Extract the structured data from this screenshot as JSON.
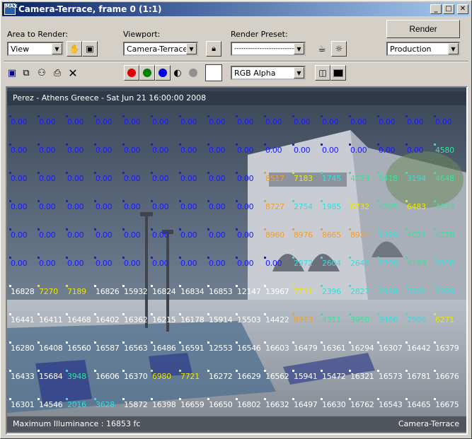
{
  "window": {
    "title": "Camera-Terrace, frame 0 (1:1)"
  },
  "toolbar": {
    "area_label": "Area to Render:",
    "area_value": "View",
    "viewport_label": "Viewport:",
    "viewport_value": "Camera-Terrace",
    "preset_label": "Render Preset:",
    "preset_value": "--------------------------",
    "render_label": "Render",
    "mode_value": "Production",
    "channel_value": "RGB Alpha"
  },
  "colors": {
    "blue": "#1a1aff",
    "yellow": "#e8e800",
    "orange": "#f0a030",
    "cyan": "#2ee0e0",
    "green": "#2ee89a",
    "white": "#ffffff"
  },
  "viewport": {
    "header": "Perez - Athens Greece - Sat Jun 21 16:00:00 2008",
    "footer_left": "Maximum Illuminance : 16853 fc",
    "footer_right": "Camera-Terrace"
  },
  "grid": {
    "rows": [
      [
        [
          "0.00",
          "b"
        ],
        [
          "0.00",
          "b"
        ],
        [
          "0.00",
          "b"
        ],
        [
          "0.00",
          "b"
        ],
        [
          "0.00",
          "b"
        ],
        [
          "0.00",
          "b"
        ],
        [
          "0.00",
          "b"
        ],
        [
          "0.00",
          "b"
        ],
        [
          "0.00",
          "b"
        ],
        [
          "0.00",
          "b"
        ],
        [
          "0.00",
          "b"
        ],
        [
          "0.00",
          "b"
        ],
        [
          "0.00",
          "b"
        ],
        [
          "0.00",
          "b"
        ],
        [
          "0.00",
          "b"
        ],
        [
          "0.00",
          "b"
        ]
      ],
      [
        [
          "0.00",
          "b"
        ],
        [
          "0.00",
          "b"
        ],
        [
          "0.00",
          "b"
        ],
        [
          "0.00",
          "b"
        ],
        [
          "0.00",
          "b"
        ],
        [
          "0.00",
          "b"
        ],
        [
          "0.00",
          "b"
        ],
        [
          "0.00",
          "b"
        ],
        [
          "0.00",
          "b"
        ],
        [
          "0.00",
          "b"
        ],
        [
          "0.00",
          "b"
        ],
        [
          "0.00",
          "b"
        ],
        [
          "0.00",
          "b"
        ],
        [
          "0.00",
          "b"
        ],
        [
          "0.00",
          "b"
        ],
        [
          "4580",
          "g"
        ]
      ],
      [
        [
          "0.00",
          "b"
        ],
        [
          "0.00",
          "b"
        ],
        [
          "0.00",
          "b"
        ],
        [
          "0.00",
          "b"
        ],
        [
          "0.00",
          "b"
        ],
        [
          "0.00",
          "b"
        ],
        [
          "0.00",
          "b"
        ],
        [
          "0.00",
          "b"
        ],
        [
          "0.00",
          "b"
        ],
        [
          "8517",
          "o"
        ],
        [
          "7183",
          "y"
        ],
        [
          "1745",
          "c"
        ],
        [
          "4273",
          "g"
        ],
        [
          "5418",
          "g"
        ],
        [
          "3194",
          "c"
        ],
        [
          "4648",
          "g"
        ]
      ],
      [
        [
          "0.00",
          "b"
        ],
        [
          "0.00",
          "b"
        ],
        [
          "0.00",
          "b"
        ],
        [
          "0.00",
          "b"
        ],
        [
          "0.00",
          "b"
        ],
        [
          "0.00",
          "b"
        ],
        [
          "0.00",
          "b"
        ],
        [
          "0.00",
          "b"
        ],
        [
          "0.00",
          "b"
        ],
        [
          "8727",
          "o"
        ],
        [
          "2754",
          "c"
        ],
        [
          "1985",
          "c"
        ],
        [
          "6732",
          "y"
        ],
        [
          "4205",
          "g"
        ],
        [
          "6483",
          "y"
        ],
        [
          "4634",
          "g"
        ]
      ],
      [
        [
          "0.00",
          "b"
        ],
        [
          "0.00",
          "b"
        ],
        [
          "0.00",
          "b"
        ],
        [
          "0.00",
          "b"
        ],
        [
          "0.00",
          "b"
        ],
        [
          "0.00",
          "b"
        ],
        [
          "0.00",
          "b"
        ],
        [
          "0.00",
          "b"
        ],
        [
          "0.00",
          "b"
        ],
        [
          "8960",
          "o"
        ],
        [
          "8976",
          "o"
        ],
        [
          "8665",
          "o"
        ],
        [
          "8924",
          "o"
        ],
        [
          "1326",
          "c"
        ],
        [
          "4621",
          "g"
        ],
        [
          "4278",
          "g"
        ]
      ],
      [
        [
          "0.00",
          "b"
        ],
        [
          "0.00",
          "b"
        ],
        [
          "0.00",
          "b"
        ],
        [
          "0.00",
          "b"
        ],
        [
          "0.00",
          "b"
        ],
        [
          "0.00",
          "b"
        ],
        [
          "0.00",
          "b"
        ],
        [
          "0.00",
          "b"
        ],
        [
          "0.00",
          "b"
        ],
        [
          "0.00",
          "b"
        ],
        [
          "2972",
          "c"
        ],
        [
          "2604",
          "c"
        ],
        [
          "2642",
          "c"
        ],
        [
          "2730",
          "c"
        ],
        [
          "4193",
          "g"
        ],
        [
          "3636",
          "c"
        ]
      ],
      [
        [
          "16828",
          "w"
        ],
        [
          "7270",
          "y"
        ],
        [
          "7189",
          "y"
        ],
        [
          "16826",
          "w"
        ],
        [
          "15932",
          "w"
        ],
        [
          "16824",
          "w"
        ],
        [
          "16834",
          "w"
        ],
        [
          "16853",
          "w"
        ],
        [
          "12147",
          "w"
        ],
        [
          "13967",
          "w"
        ],
        [
          "7711",
          "y"
        ],
        [
          "2396",
          "c"
        ],
        [
          "2827",
          "c"
        ],
        [
          "2938",
          "c"
        ],
        [
          "3301",
          "c"
        ],
        [
          "2289",
          "c"
        ]
      ],
      [
        [
          "16441",
          "w"
        ],
        [
          "16411",
          "w"
        ],
        [
          "16468",
          "w"
        ],
        [
          "16402",
          "w"
        ],
        [
          "16362",
          "w"
        ],
        [
          "16215",
          "w"
        ],
        [
          "16178",
          "w"
        ],
        [
          "15914",
          "w"
        ],
        [
          "15503",
          "w"
        ],
        [
          "14422",
          "w"
        ],
        [
          "8913",
          "o"
        ],
        [
          "4311",
          "g"
        ],
        [
          "3950",
          "g"
        ],
        [
          "3486",
          "c"
        ],
        [
          "2504",
          "c"
        ],
        [
          "6271",
          "y"
        ]
      ],
      [
        [
          "16280",
          "w"
        ],
        [
          "16408",
          "w"
        ],
        [
          "16560",
          "w"
        ],
        [
          "16587",
          "w"
        ],
        [
          "16563",
          "w"
        ],
        [
          "16486",
          "w"
        ],
        [
          "16591",
          "w"
        ],
        [
          "12553",
          "w"
        ],
        [
          "16546",
          "w"
        ],
        [
          "16603",
          "w"
        ],
        [
          "16479",
          "w"
        ],
        [
          "16361",
          "w"
        ],
        [
          "16294",
          "w"
        ],
        [
          "16307",
          "w"
        ],
        [
          "16442",
          "w"
        ],
        [
          "16379",
          "w"
        ]
      ],
      [
        [
          "16433",
          "w"
        ],
        [
          "15684",
          "w"
        ],
        [
          "3948",
          "g"
        ],
        [
          "16606",
          "w"
        ],
        [
          "16370",
          "w"
        ],
        [
          "6980",
          "y"
        ],
        [
          "7721",
          "y"
        ],
        [
          "16272",
          "w"
        ],
        [
          "16629",
          "w"
        ],
        [
          "16562",
          "w"
        ],
        [
          "15941",
          "w"
        ],
        [
          "15472",
          "w"
        ],
        [
          "16321",
          "w"
        ],
        [
          "16573",
          "w"
        ],
        [
          "16781",
          "w"
        ],
        [
          "16676",
          "w"
        ]
      ],
      [
        [
          "16301",
          "w"
        ],
        [
          "14546",
          "w"
        ],
        [
          "2016",
          "c"
        ],
        [
          "3628",
          "c"
        ],
        [
          "15872",
          "w"
        ],
        [
          "16398",
          "w"
        ],
        [
          "16659",
          "w"
        ],
        [
          "16650",
          "w"
        ],
        [
          "16802",
          "w"
        ],
        [
          "16632",
          "w"
        ],
        [
          "16497",
          "w"
        ],
        [
          "16630",
          "w"
        ],
        [
          "16762",
          "w"
        ],
        [
          "16543",
          "w"
        ],
        [
          "16465",
          "w"
        ],
        [
          "16675",
          "w"
        ]
      ]
    ]
  }
}
